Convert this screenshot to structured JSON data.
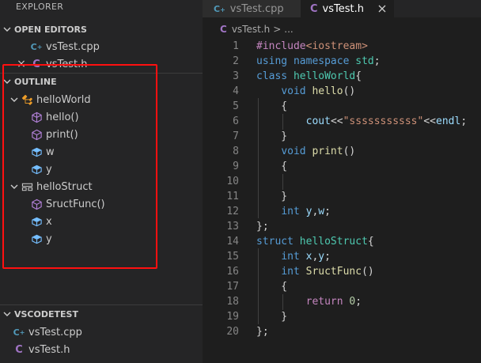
{
  "sidebar": {
    "title": "EXPLORER",
    "open_editors": {
      "header": "OPEN EDITORS",
      "items": [
        {
          "icon": "C",
          "label": "vsTest.cpp"
        },
        {
          "icon": "C",
          "label": "vsTest.h",
          "close": "×"
        }
      ]
    },
    "outline": {
      "header": "OUTLINE",
      "items": [
        {
          "label": "helloWorld",
          "kind": "class"
        },
        {
          "label": "hello()",
          "kind": "method"
        },
        {
          "label": "print()",
          "kind": "method"
        },
        {
          "label": "w",
          "kind": "field"
        },
        {
          "label": "y",
          "kind": "field"
        },
        {
          "label": "helloStruct",
          "kind": "struct"
        },
        {
          "label": "SructFunc()",
          "kind": "method"
        },
        {
          "label": "x",
          "kind": "field"
        },
        {
          "label": "y",
          "kind": "field"
        }
      ]
    },
    "project": {
      "header": "VSCODETEST",
      "items": [
        {
          "icon": "C",
          "label": "vsTest.cpp"
        },
        {
          "icon": "C",
          "label": "vsTest.h"
        }
      ]
    }
  },
  "tabs": [
    {
      "icon": "C",
      "label": "vsTest.cpp",
      "active": false
    },
    {
      "icon": "C",
      "label": "vsTest.h",
      "active": true
    }
  ],
  "breadcrumb": {
    "icon": "C",
    "file": "vsTest.h",
    "sep": ">",
    "more": "..."
  },
  "editor": {
    "line_numbers": [
      "1",
      "2",
      "3",
      "4",
      "5",
      "6",
      "7",
      "8",
      "9",
      "10",
      "11",
      "12",
      "13",
      "14",
      "15",
      "16",
      "17",
      "18",
      "19",
      "20"
    ],
    "lines": [
      [
        {
          "t": "#include",
          "c": "cf"
        },
        {
          "t": "<iostream>",
          "c": "st"
        }
      ],
      [
        {
          "t": "using ",
          "c": "kw"
        },
        {
          "t": "namespace ",
          "c": "kw"
        },
        {
          "t": "std",
          "c": "ty"
        },
        {
          "t": ";",
          "c": "pl"
        }
      ],
      [
        {
          "t": "class ",
          "c": "kw"
        },
        {
          "t": "helloWorld",
          "c": "ty"
        },
        {
          "t": "{",
          "c": "pl"
        }
      ],
      [
        {
          "t": "    ",
          "c": "pl"
        },
        {
          "t": "void ",
          "c": "kw"
        },
        {
          "t": "hello",
          "c": "fn"
        },
        {
          "t": "()",
          "c": "pl"
        }
      ],
      [
        {
          "t": "    {",
          "c": "pl"
        }
      ],
      [
        {
          "t": "        ",
          "c": "pl"
        },
        {
          "t": "cout",
          "c": "vr"
        },
        {
          "t": "<<",
          "c": "pl"
        },
        {
          "t": "\"sssssssssss\"",
          "c": "st"
        },
        {
          "t": "<<",
          "c": "pl"
        },
        {
          "t": "endl",
          "c": "vr"
        },
        {
          "t": ";",
          "c": "pl"
        }
      ],
      [
        {
          "t": "    }",
          "c": "pl"
        }
      ],
      [
        {
          "t": "    ",
          "c": "pl"
        },
        {
          "t": "void ",
          "c": "kw"
        },
        {
          "t": "print",
          "c": "fn"
        },
        {
          "t": "()",
          "c": "pl"
        }
      ],
      [
        {
          "t": "    {",
          "c": "pl"
        }
      ],
      [
        {
          "t": "",
          "c": "pl"
        }
      ],
      [
        {
          "t": "    }",
          "c": "pl"
        }
      ],
      [
        {
          "t": "    ",
          "c": "pl"
        },
        {
          "t": "int ",
          "c": "kw"
        },
        {
          "t": "y",
          "c": "vr"
        },
        {
          "t": ",",
          "c": "pl"
        },
        {
          "t": "w",
          "c": "vr"
        },
        {
          "t": ";",
          "c": "pl"
        }
      ],
      [
        {
          "t": "};",
          "c": "pl"
        }
      ],
      [
        {
          "t": "struct ",
          "c": "kw"
        },
        {
          "t": "helloStruct",
          "c": "ty"
        },
        {
          "t": "{",
          "c": "pl"
        }
      ],
      [
        {
          "t": "    ",
          "c": "pl"
        },
        {
          "t": "int ",
          "c": "kw"
        },
        {
          "t": "x",
          "c": "vr"
        },
        {
          "t": ",",
          "c": "pl"
        },
        {
          "t": "y",
          "c": "vr"
        },
        {
          "t": ";",
          "c": "pl"
        }
      ],
      [
        {
          "t": "    ",
          "c": "pl"
        },
        {
          "t": "int ",
          "c": "kw"
        },
        {
          "t": "SructFunc",
          "c": "fn"
        },
        {
          "t": "()",
          "c": "pl"
        }
      ],
      [
        {
          "t": "    {",
          "c": "pl"
        }
      ],
      [
        {
          "t": "        ",
          "c": "pl"
        },
        {
          "t": "return ",
          "c": "cf"
        },
        {
          "t": "0",
          "c": "nm"
        },
        {
          "t": ";",
          "c": "pl"
        }
      ],
      [
        {
          "t": "    }",
          "c": "pl"
        }
      ],
      [
        {
          "t": "};",
          "c": "pl"
        }
      ]
    ]
  },
  "colors": {
    "highlight_box": "#ff1010",
    "class_icon": "#ee9d28",
    "method_icon": "#b180d7",
    "field_icon": "#75beff",
    "c_header_icon": "#a074c4",
    "cpp_icon": "#519aba"
  }
}
